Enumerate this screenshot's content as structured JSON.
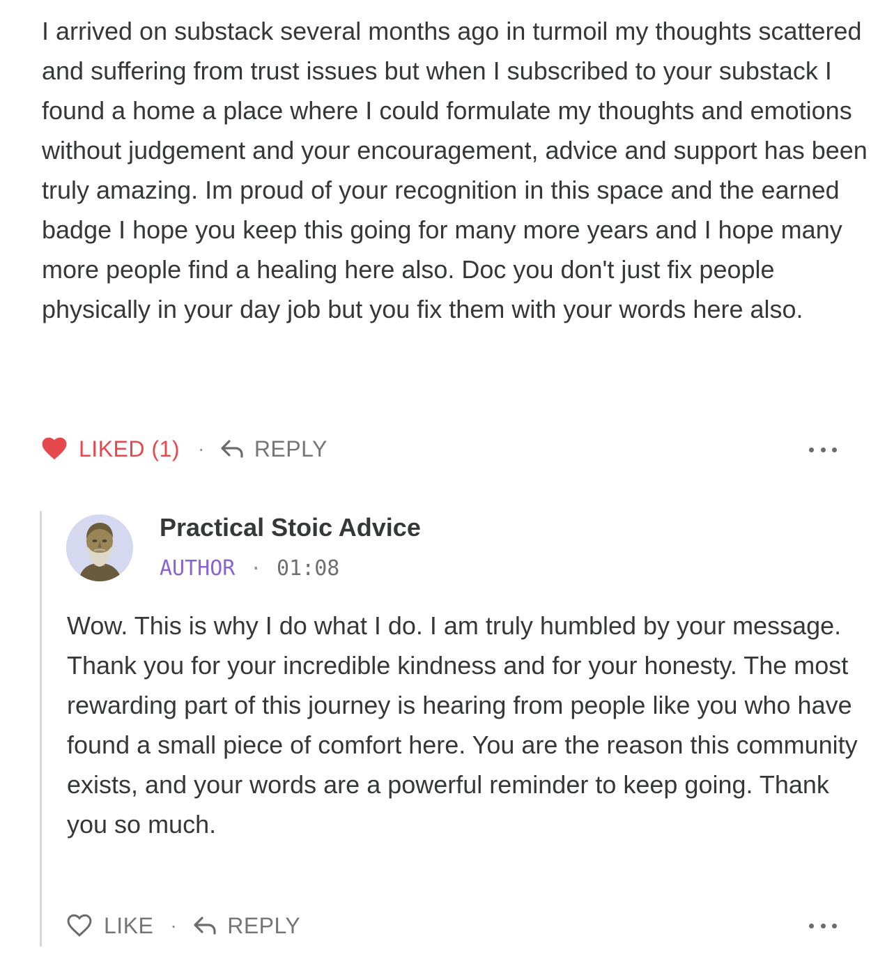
{
  "comment": {
    "body": "I arrived on substack several months ago in turmoil my thoughts scattered and suffering from trust issues but when I subscribed to your substack I found a home a place where I could formulate my thoughts and emotions without judgement and your encouragement, advice and support has been truly amazing. Im proud of your recognition in this space and the earned badge I hope you keep this going for many more years and I hope many more people find a healing here also. Doc you don't just fix people physically in your day job but you fix them with your words here also.",
    "actions": {
      "like_label": "LIKED (1)",
      "separator": "·",
      "reply_label": "REPLY",
      "liked": true
    }
  },
  "reply": {
    "author": "Practical Stoic Advice",
    "badge": "AUTHOR",
    "separator": "·",
    "timestamp": "01:08",
    "body": "Wow. This is why I do what I do. I am truly humbled by your message. Thank you for your incredible kindness and for your honesty. The most rewarding part of this journey is hearing from people like you who have found a small piece of comfort here. You are the reason this community exists, and your words are a powerful reminder to keep going. Thank you so much.",
    "actions": {
      "like_label": "LIKE",
      "separator": "·",
      "reply_label": "REPLY",
      "liked": false
    }
  },
  "icons": {
    "liked": "heart-filled-icon",
    "like": "heart-outline-icon",
    "reply": "reply-arrow-icon",
    "more": "more-options-icon",
    "avatar": "stoic-bust-avatar"
  },
  "colors": {
    "liked": "#e5484d",
    "author_badge": "#8a63d2",
    "text": "#363737",
    "muted": "#757575",
    "avatar_bg": "#d5d8ef",
    "thread_line": "#d7d7d7"
  }
}
